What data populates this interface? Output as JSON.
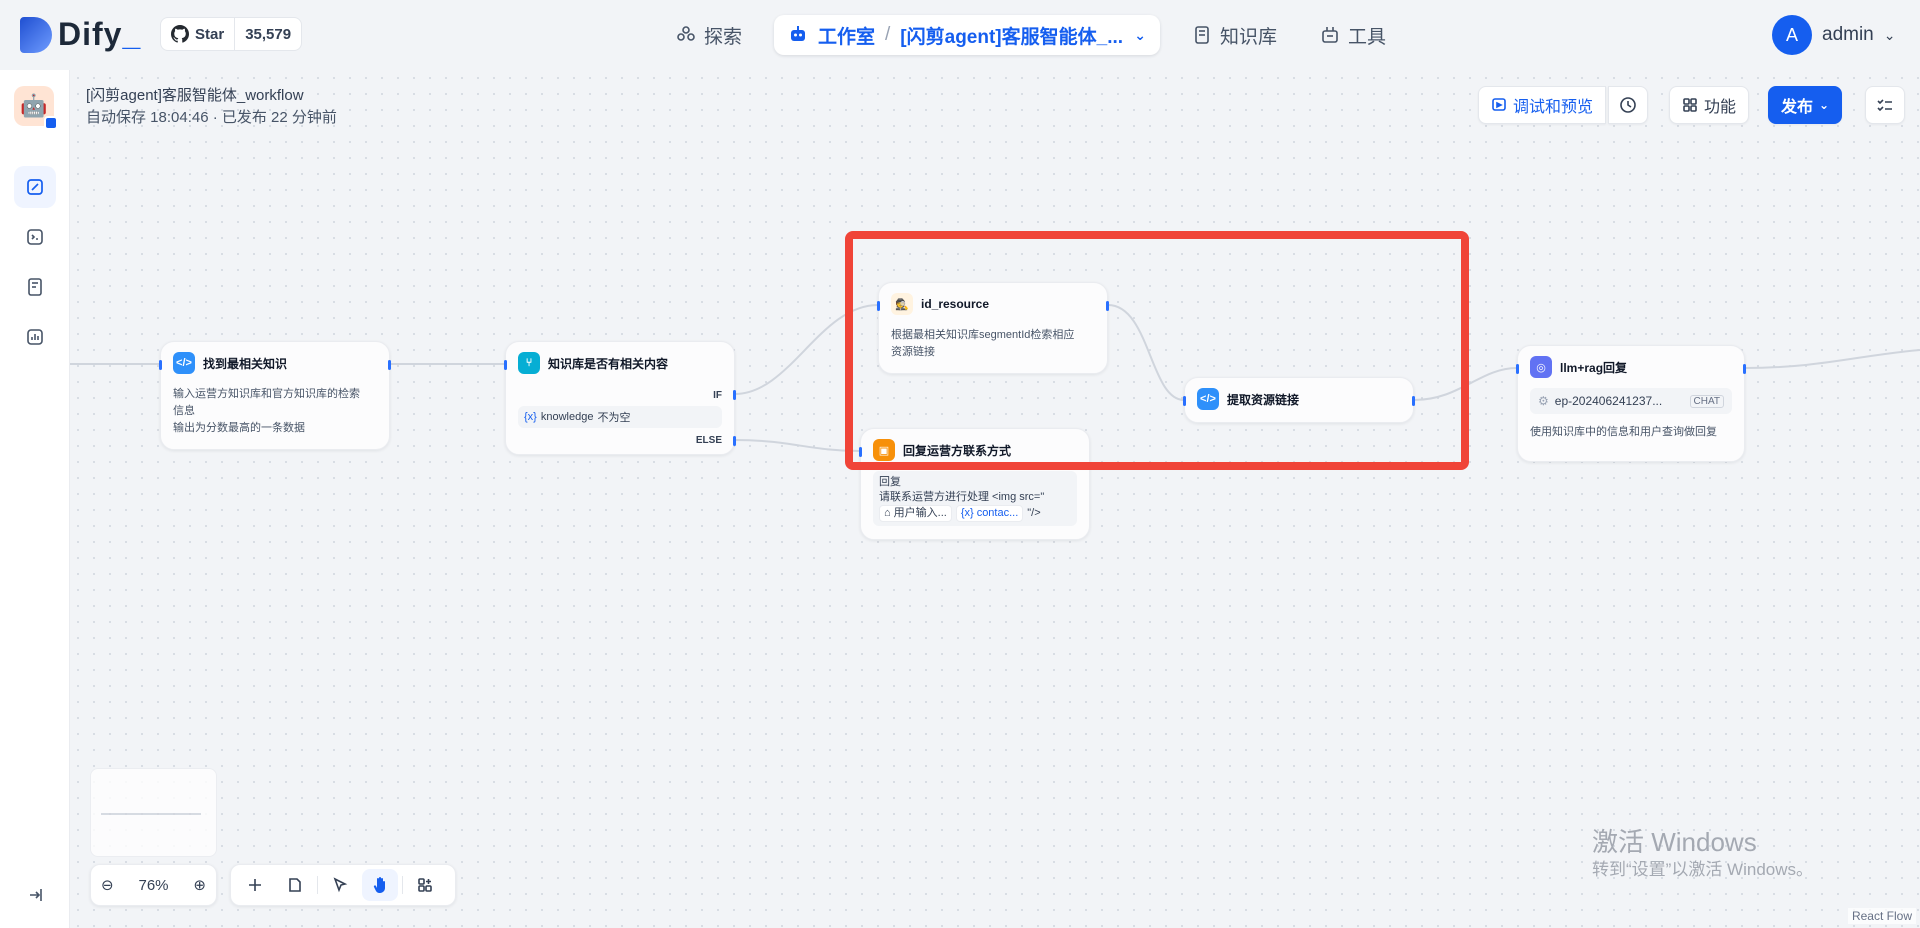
{
  "brand": {
    "name": "Dify"
  },
  "github": {
    "star_label": "Star",
    "star_count": "35,579"
  },
  "nav": {
    "explore": "探索",
    "studio": "工作室",
    "current_app": "[闪剪agent]客服智能体_...",
    "knowledge": "知识库",
    "tools": "工具"
  },
  "user": {
    "initial": "A",
    "name": "admin"
  },
  "app": {
    "title": "[闪剪agent]客服智能体_workflow",
    "subtitle": "自动保存 18:04:46 · 已发布 22 分钟前"
  },
  "toolbar": {
    "debug_label": "调试和预览",
    "features_label": "功能",
    "publish_label": "发布"
  },
  "nodes": {
    "find": {
      "title": "找到最相关知识",
      "desc": "输入运营方知识库和官方知识库的检索\n信息\n输出为分数最高的一条数据"
    },
    "ifelse": {
      "title": "知识库是否有相关内容",
      "if_label": "IF",
      "else_label": "ELSE",
      "condition_var": "knowledge",
      "condition_op": "不为空"
    },
    "id_resource": {
      "title": "id_resource",
      "desc": "根据最相关知识库segmentId检索相应\n资源链接"
    },
    "extract": {
      "title": "提取资源链接"
    },
    "reply": {
      "title": "回复运营方联系方式",
      "label": "回复",
      "line1": "请联系运营方进行处理 <img src=\"",
      "chip1": "用户输入...",
      "chip2": "contac...",
      "tail": "\"/>"
    },
    "llm": {
      "title": "llm+rag回复",
      "model": "ep-202406241237...",
      "model_tag": "CHAT",
      "desc": "使用知识库中的信息和用户查询做回复"
    }
  },
  "zoom": {
    "level": "76%"
  },
  "watermark": {
    "line1": "激活 Windows",
    "line2": "转到“设置”以激活 Windows。"
  },
  "attribution": "React Flow",
  "colors": {
    "accent": "#155eef",
    "highlight": "#f04438"
  }
}
